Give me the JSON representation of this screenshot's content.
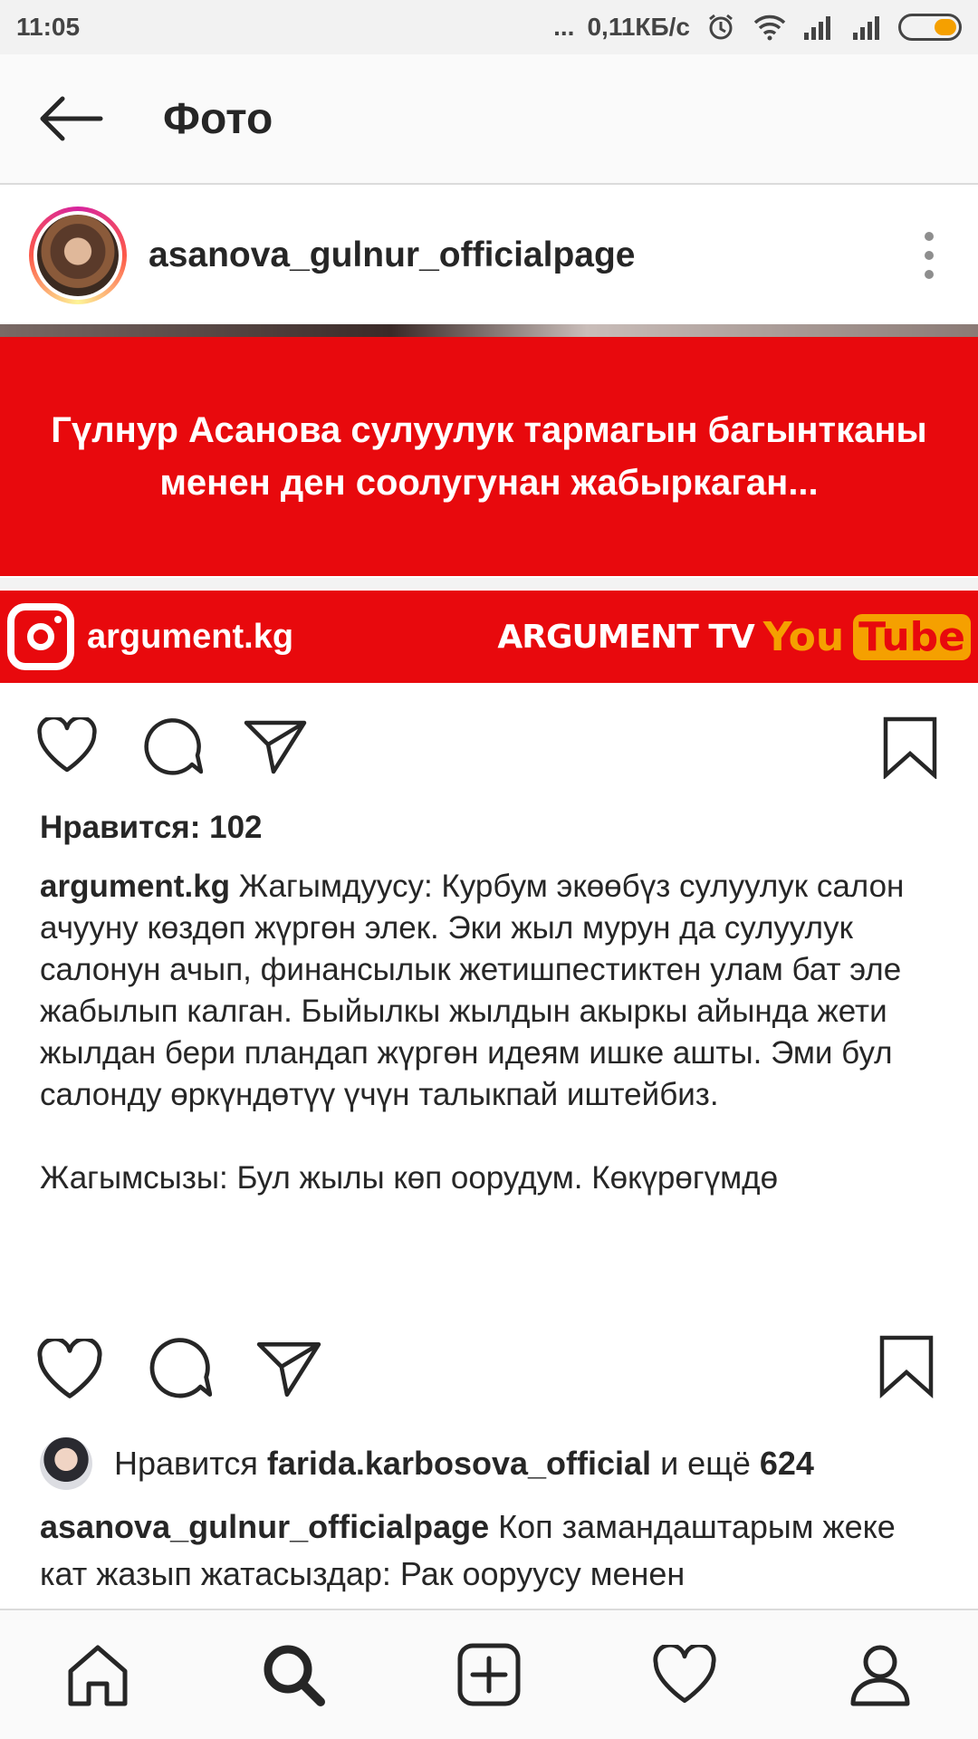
{
  "status_bar": {
    "time": "11:05",
    "dots": "...",
    "network_speed": "0,11КБ/с",
    "icons": [
      "alarm-icon",
      "wifi-icon",
      "signal-icon",
      "signal-icon",
      "battery-icon"
    ],
    "battery_color": "#f5a000"
  },
  "header": {
    "back_icon": "arrow-left-icon",
    "title": "Фото"
  },
  "post1": {
    "username": "asanova_gulnur_officialpage",
    "more_icon": "more-vertical-icon",
    "image": {
      "headline_line1": "Гүлнур Асанова сулуулук тармагын багынтканы",
      "headline_line2": "менен ден соолугунан жабыркаган...",
      "brand_handle": "argument.kg",
      "brand_tv": "ARGUMENT TV",
      "youtube_you": "You",
      "youtube_tube": "Tube",
      "accent": "#e8090d"
    },
    "likes_label": "Нравится: 102",
    "caption_user": "argument.kg",
    "caption_p1": "Жагымдуусу: Курбум экөөбүз сулуулук салон ачууну көздөп жүргөн элек. Эки жыл мурун да сулуулук салонун ачып, финансылык жетишпестиктен улам бат эле жабылып калган. Быйылкы жылдын акыркы айында жети жылдан бери пландап жүргөн идеям ишке ашты. Эми бул салонду өркүндөтүү  үчүн талыкпай иштейбиз.",
    "caption_p2": "Жагымсызы: Бул жылы көп оорудум. Көкүрөгүмдө"
  },
  "post2": {
    "liked_prefix": "Нравится",
    "liked_user": "farida.karbosova_official",
    "liked_mid": "и ещё",
    "liked_count": "624",
    "caption_user": "asanova_gulnur_officialpage",
    "caption_text": "Коп замандаштарым жеке кат жазып жатасыздар: Рак ооруусу менен"
  },
  "bottom_nav": {
    "items": [
      "home-icon",
      "search-icon",
      "add-post-icon",
      "activity-heart-icon",
      "profile-icon"
    ]
  }
}
